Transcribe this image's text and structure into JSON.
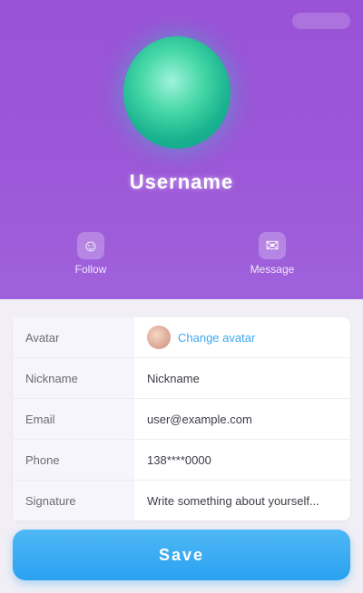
{
  "profile": {
    "username": "Username"
  },
  "actions": [
    {
      "label": "Follow",
      "icon": "person-icon"
    },
    {
      "label": "Message",
      "icon": "message-icon"
    }
  ],
  "details": [
    {
      "label": "Avatar",
      "value": "Change avatar"
    },
    {
      "label": "Nickname",
      "value": "Nickname"
    },
    {
      "label": "Email",
      "value": "user@example.com"
    },
    {
      "label": "Phone",
      "value": "138****0000"
    },
    {
      "label": "Signature",
      "value": "Write something about yourself..."
    }
  ],
  "primary_button": {
    "label": "Save"
  },
  "colors": {
    "hero": "#9c58d8",
    "accent": "#2aa1f0",
    "avatar": "#19b38f"
  }
}
